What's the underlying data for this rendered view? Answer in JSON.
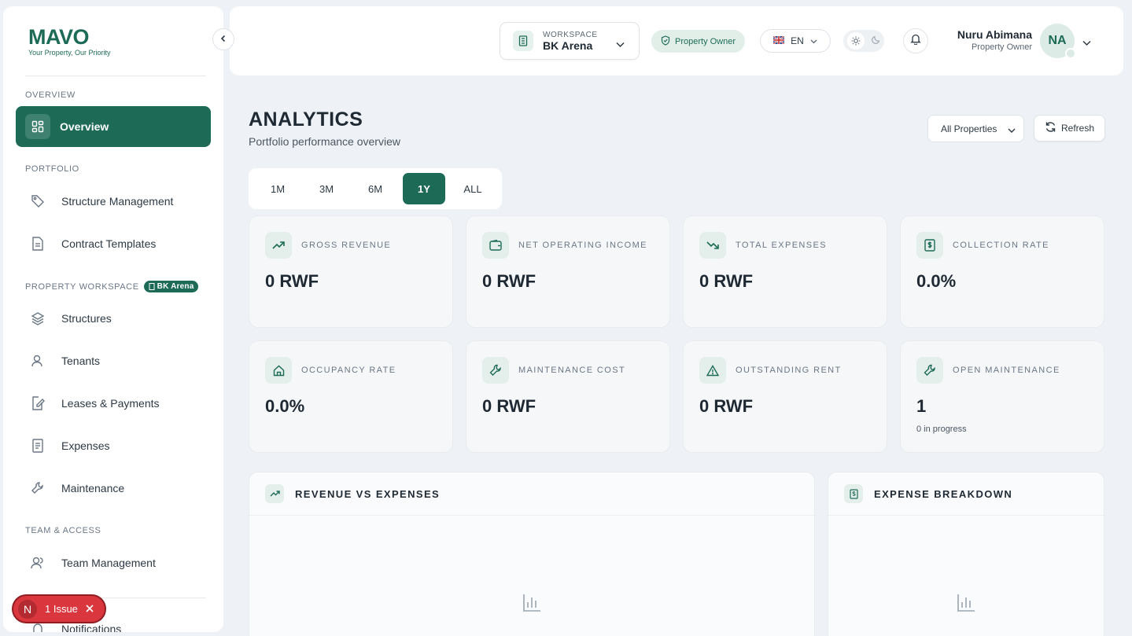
{
  "brand": {
    "name": "MAVO",
    "tagline": "Your Property, Our Priority",
    "accent": "#1d6b57"
  },
  "sidebar": {
    "sections": {
      "overview": "OVERVIEW",
      "portfolio": "PORTFOLIO",
      "property_workspace": "PROPERTY WORKSPACE",
      "team_access": "TEAM & ACCESS"
    },
    "workspace_badge": "BK Arena",
    "items": [
      {
        "label": "Overview",
        "icon": "dashboard-icon",
        "active": true
      },
      {
        "label": "Structure Management",
        "icon": "tag-icon"
      },
      {
        "label": "Contract Templates",
        "icon": "document-icon"
      },
      {
        "label": "Structures",
        "icon": "layers-icon"
      },
      {
        "label": "Tenants",
        "icon": "user-icon"
      },
      {
        "label": "Leases & Payments",
        "icon": "edit-document-icon"
      },
      {
        "label": "Expenses",
        "icon": "receipt-icon"
      },
      {
        "label": "Maintenance",
        "icon": "wrench-icon"
      },
      {
        "label": "Team Management",
        "icon": "users-icon"
      },
      {
        "label": "Notifications",
        "icon": "bell-icon"
      }
    ]
  },
  "issue_badge": {
    "initial": "N",
    "label": "1 Issue"
  },
  "topbar": {
    "workspace_label": "WORKSPACE",
    "workspace_name": "BK Arena",
    "role": "Property Owner",
    "language": "EN",
    "user_name": "Nuru Abimana",
    "user_role": "Property Owner",
    "avatar_initials": "NA"
  },
  "page": {
    "title": "ANALYTICS",
    "subtitle": "Portfolio performance overview",
    "property_filter": "All Properties",
    "refresh_label": "Refresh"
  },
  "periods": [
    {
      "label": "1M"
    },
    {
      "label": "3M"
    },
    {
      "label": "6M"
    },
    {
      "label": "1Y",
      "active": true
    },
    {
      "label": "ALL"
    }
  ],
  "kpis": [
    {
      "label": "GROSS REVENUE",
      "value": "0 RWF",
      "icon": "trending-up-icon"
    },
    {
      "label": "NET OPERATING INCOME",
      "value": "0 RWF",
      "icon": "wallet-icon"
    },
    {
      "label": "TOTAL EXPENSES",
      "value": "0 RWF",
      "icon": "trending-down-icon"
    },
    {
      "label": "COLLECTION RATE",
      "value": "0.0%",
      "icon": "dollar-receipt-icon"
    },
    {
      "label": "OCCUPANCY RATE",
      "value": "0.0%",
      "icon": "home-icon"
    },
    {
      "label": "MAINTENANCE COST",
      "value": "0 RWF",
      "icon": "wrench-icon"
    },
    {
      "label": "OUTSTANDING RENT",
      "value": "0 RWF",
      "icon": "warning-icon"
    },
    {
      "label": "OPEN MAINTENANCE",
      "value": "1",
      "note": "0 in progress",
      "icon": "wrench-icon"
    }
  ],
  "panels": {
    "revenue": {
      "title": "REVENUE VS EXPENSES",
      "icon": "trending-up-icon"
    },
    "breakdown": {
      "title": "EXPENSE BREAKDOWN",
      "icon": "dollar-receipt-icon"
    }
  }
}
